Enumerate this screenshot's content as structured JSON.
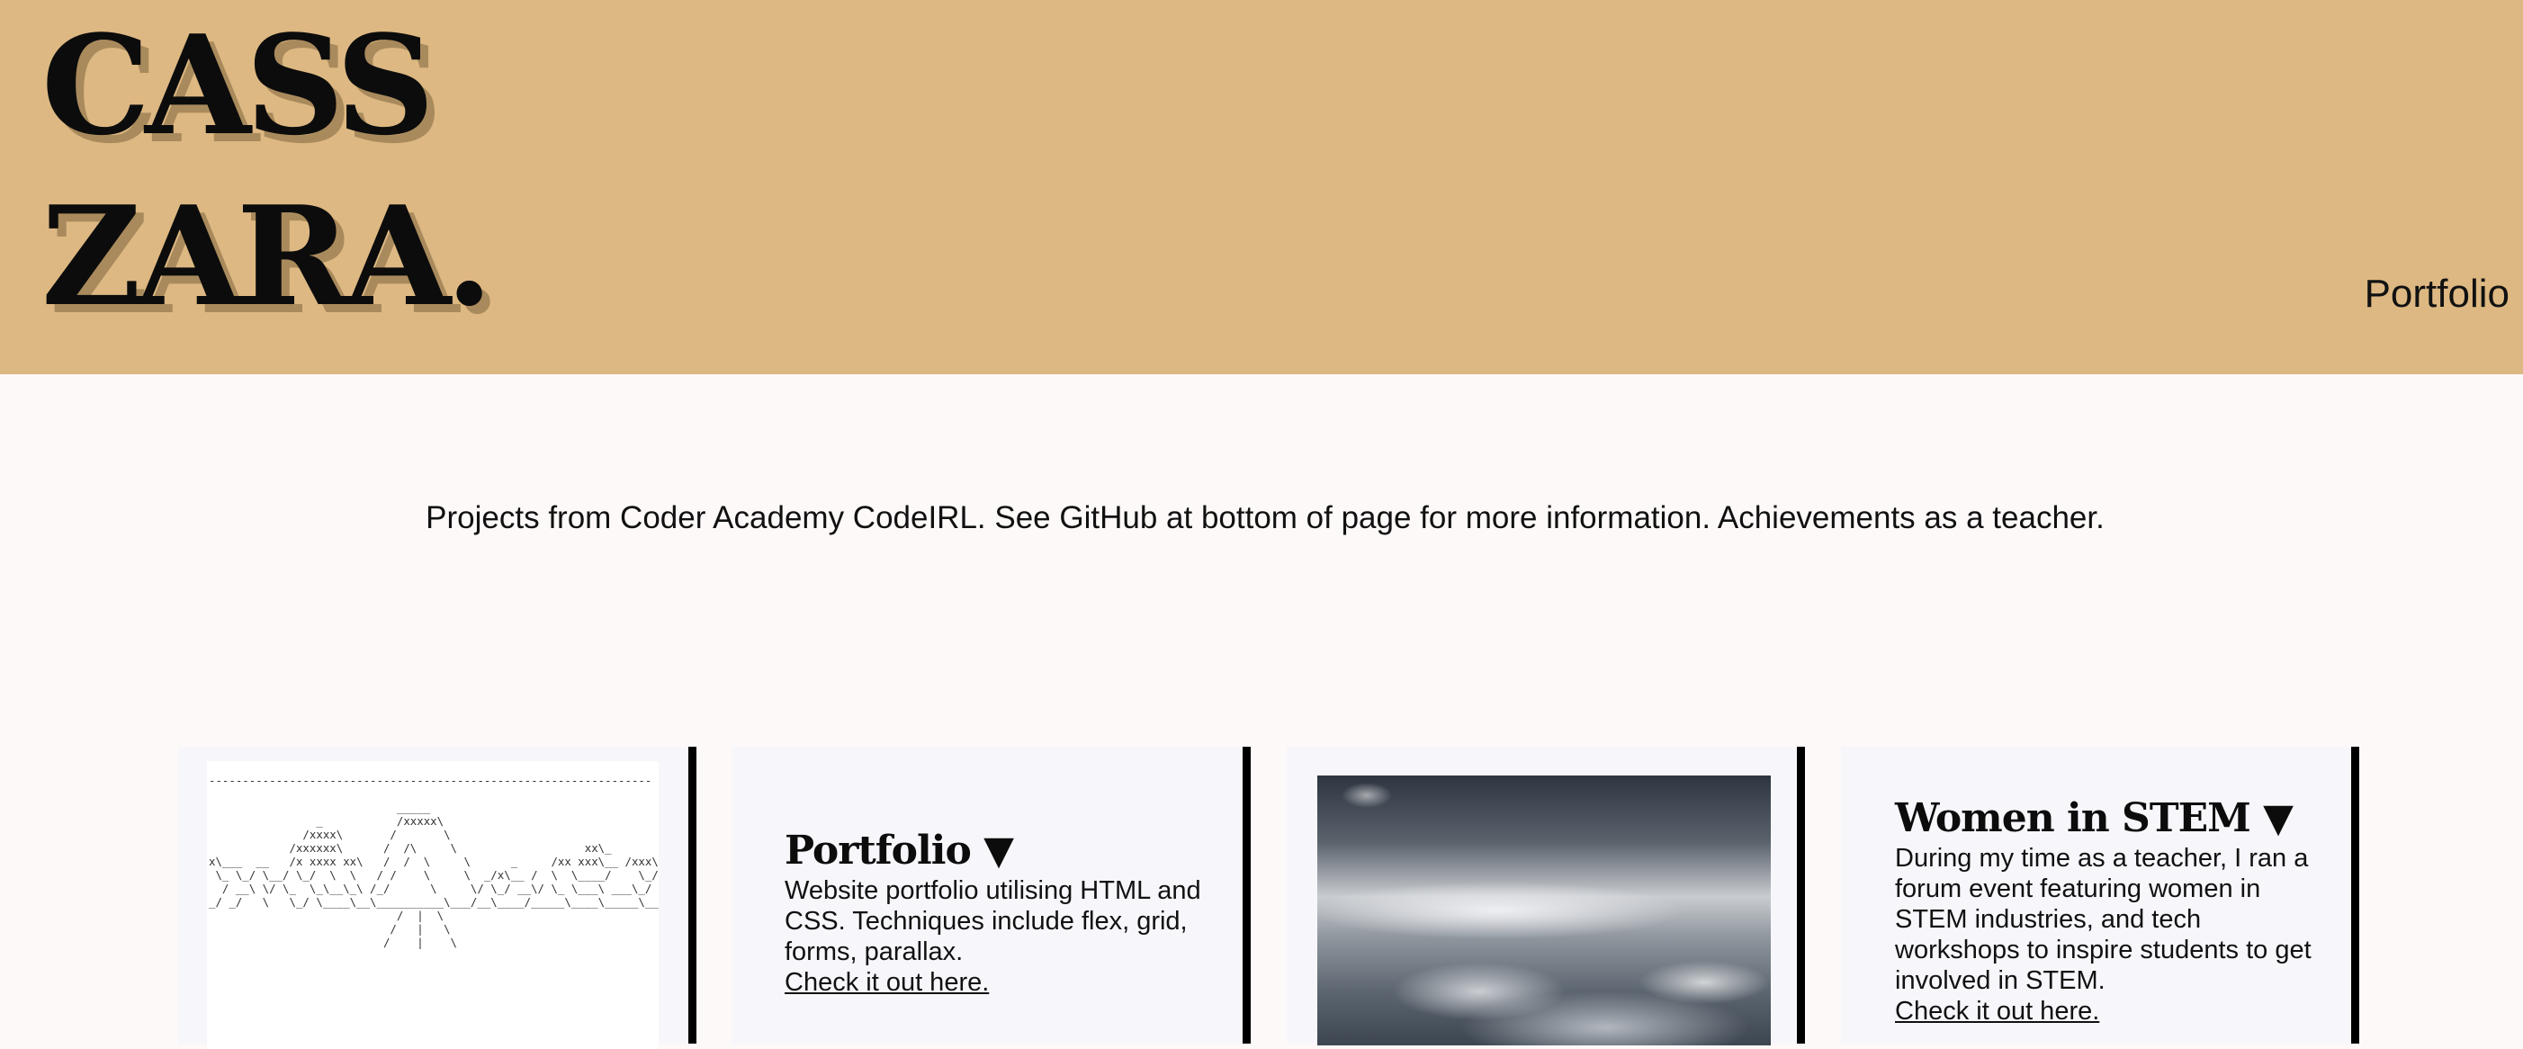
{
  "header": {
    "brand_line1": "CASS",
    "brand_line2": "ZARA.",
    "nav_link": "Portfolio",
    "background": "#ddb882"
  },
  "intro": {
    "text": "Projects from Coder Academy CodeIRL. See GitHub at bottom of page for more information. Achievements as a teacher."
  },
  "cards": [
    {
      "type": "image",
      "image_desc": "ascii-art-mountains",
      "ascii": "------------------------------------------------------------------\n\n                            _____\n                _           /xxxxx\\\n              /xxxx\\       /       \\\n            /xxxxxx\\      /  /\\     \\                   xx\\_\nx\\___  __   /x xxxx xx\\   /  /  \\     \\      _     /xx xxx\\__ /xxx\\\n \\_ \\_/ \\__/ \\_/  \\  \\   / /    \\     \\  _/x\\__ /  \\  \\____/    \\_/\n  / __\\ \\/ \\_  \\_\\__\\_\\ /_/      \\     \\/ \\_/ __\\/ \\_ \\___\\ ___\\_/\n_/ _/   \\   \\_/ \\____\\__\\__________\\___/__\\____/_____\\____\\_____\\__/\n                            /  |  \\\n                           /   |   \\\n                          /    |    \\"
    },
    {
      "type": "text",
      "title": "Portfolio ▼",
      "body": "Website portfolio utilising HTML and CSS. Techniques include flex, grid, forms, parallax.",
      "link": "Check it out here."
    },
    {
      "type": "image",
      "image_desc": "cloudy-sky-photo"
    },
    {
      "type": "text",
      "title": "Women in STEM ▼",
      "body": "During my time as a teacher, I ran a forum event featuring women in STEM industries, and tech workshops to inspire students to get involved in STEM.",
      "link": "Check it out here."
    }
  ]
}
